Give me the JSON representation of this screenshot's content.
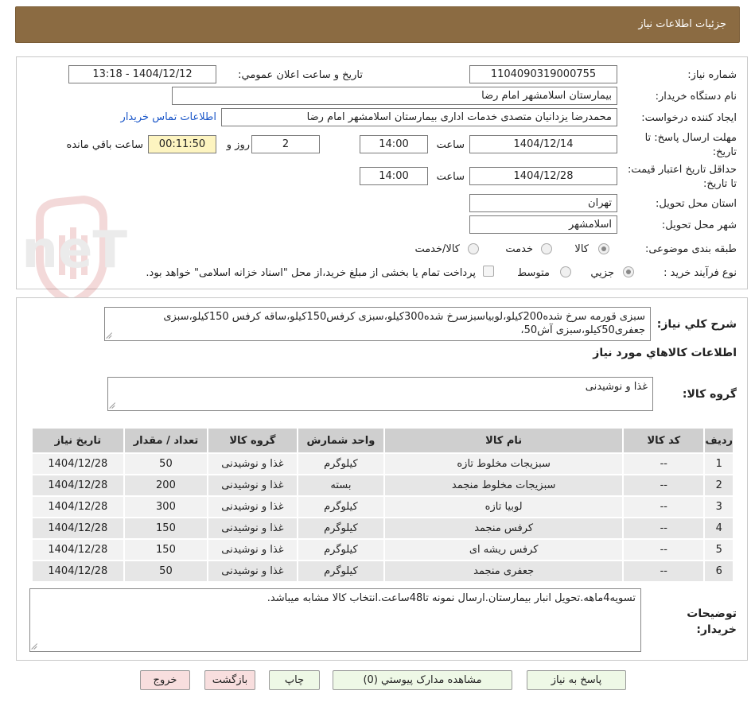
{
  "header": {
    "title": "جزئيات اطلاعات نياز"
  },
  "watermark": {
    "text": "AriaTender.neT"
  },
  "form": {
    "need_number_label": "شماره نياز:",
    "need_number": "1104090319000755",
    "announce_label": "تاريخ و ساعت اعلان عمومي:",
    "announce_value": "1404/12/12 - 13:18",
    "buyer_org_label": "نام دستگاه خريدار:",
    "buyer_org": "بیمارستان اسلامشهر   امام رضا",
    "requester_label": "ايجاد کننده درخواست:",
    "requester": "محمدرضا یزدانیان متصدی خدمات اداری بیمارستان اسلامشهر   امام رضا",
    "contact_link": "اطلاعات تماس خريدار",
    "deadline_label": "مهلت ارسال پاسخ: تا تاريخ:",
    "deadline_date": "1404/12/14",
    "time_label": "ساعت",
    "deadline_time": "14:00",
    "days_value": "2",
    "days_label": "روز و",
    "countdown": "00:11:50",
    "remaining_label": "ساعت باقي مانده",
    "validity_label": "حداقل تاريخ اعتبار قيمت: تا تاريخ:",
    "validity_date": "1404/12/28",
    "validity_time": "14:00",
    "province_label": "استان محل تحويل:",
    "province": "تهران",
    "city_label": "شهر محل تحويل:",
    "city": "اسلامشهر",
    "category_label": "طبقه بندی موضوعی:",
    "category_options": [
      "کالا",
      "خدمت",
      "کالا/خدمت"
    ],
    "category_selected": "کالا",
    "process_label": "نوع فرآيند خريد :",
    "process_options": [
      "جزيي",
      "متوسط"
    ],
    "process_selected": "جزيي",
    "payment_note": "پرداخت تمام يا بخشی از مبلغ خريد،از محل \"اسناد خزانه اسلامی\" خواهد بود."
  },
  "description": {
    "label": "شرح کلي نياز:",
    "text": "سبزی قورمه سرخ شده200کیلو،لوبیاسبزسرخ شده300کیلو،سبزی کرفس150کیلو،ساقه کرفس 150کیلو،سبزی جعفری50کیلو،سبزی آش50،"
  },
  "goods_section": {
    "title": "اطلاعات کالاهاي مورد نياز",
    "group_label": "گروه کالا:",
    "group_value": "غذا و نوشیدنی"
  },
  "table": {
    "headers": [
      "رديف",
      "کد کالا",
      "نام کالا",
      "واحد شمارش",
      "گروه کالا",
      "تعداد / مقدار",
      "تاريخ نياز"
    ],
    "rows": [
      [
        "1",
        "--",
        "سبزیجات مخلوط تازه",
        "کیلوگرم",
        "غذا و نوشیدنی",
        "50",
        "1404/12/28"
      ],
      [
        "2",
        "--",
        "سبزیجات مخلوط منجمد",
        "بسته",
        "غذا و نوشیدنی",
        "200",
        "1404/12/28"
      ],
      [
        "3",
        "--",
        "لوبیا تازه",
        "کیلوگرم",
        "غذا و نوشیدنی",
        "300",
        "1404/12/28"
      ],
      [
        "4",
        "--",
        "کرفس منجمد",
        "کیلوگرم",
        "غذا و نوشیدنی",
        "150",
        "1404/12/28"
      ],
      [
        "5",
        "--",
        "کرفس ریشه ای",
        "کیلوگرم",
        "غذا و نوشیدنی",
        "150",
        "1404/12/28"
      ],
      [
        "6",
        "--",
        "جعفری منجمد",
        "کیلوگرم",
        "غذا و نوشیدنی",
        "50",
        "1404/12/28"
      ]
    ]
  },
  "buyer_notes": {
    "label": "توضيحات خريدار:",
    "text": "تسویه4ماهه.تحویل انبار بیمارستان.ارسال نمونه تا48ساعت.انتخاب کالا مشابه میباشد."
  },
  "buttons": {
    "reply": "پاسخ به نياز",
    "attachments": "مشاهده مدارک پيوستي (0)",
    "print": "چاپ",
    "back": "بازگشت",
    "exit": "خروج"
  }
}
